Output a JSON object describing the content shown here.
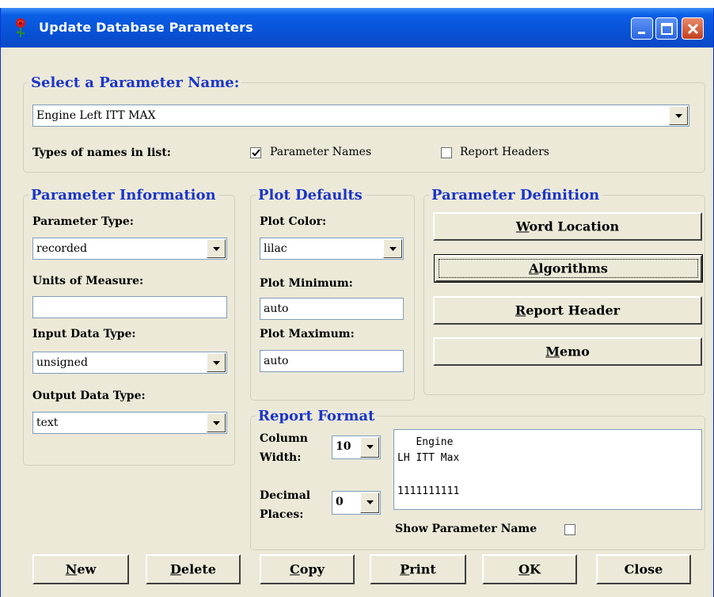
{
  "window": {
    "title": "Update Database Parameters",
    "icon": "rose-icon"
  },
  "select_group": {
    "legend": "Select a Parameter Name:",
    "selected_name": "Engine Left ITT MAX",
    "types_label": "Types of names in list:",
    "parameter_names_label": "Parameter Names",
    "parameter_names_checked": true,
    "report_headers_label": "Report Headers",
    "report_headers_checked": false
  },
  "parameter_info": {
    "legend": "Parameter Information",
    "parameter_type_label": "Parameter Type:",
    "parameter_type_value": "recorded",
    "units_label": "Units of Measure:",
    "units_value": "",
    "input_type_label": "Input Data Type:",
    "input_type_value": "unsigned",
    "output_type_label": "Output Data Type:",
    "output_type_value": "text"
  },
  "plot_defaults": {
    "legend": "Plot Defaults",
    "color_label": "Plot Color:",
    "color_value": "lilac",
    "min_label": "Plot Minimum:",
    "min_value": "auto",
    "max_label": "Plot Maximum:",
    "max_value": "auto"
  },
  "parameter_definition": {
    "legend": "Parameter Definition",
    "buttons": [
      "Word Location",
      "Algorithms",
      "Report Header",
      "Memo"
    ]
  },
  "report_format": {
    "legend": "Report Format",
    "column_width_label_1": "Column",
    "column_width_label_2": "Width:",
    "column_width_value": "10",
    "decimal_label_1": "Decimal",
    "decimal_label_2": "Places:",
    "decimal_value": "0",
    "preview_lines": [
      "   Engine",
      "LH ITT Max",
      "",
      "1111111111"
    ],
    "show_param_name_label": "Show Parameter Name",
    "show_param_name_checked": false
  },
  "bottom_buttons": [
    "New",
    "Delete",
    "Copy",
    "Print",
    "OK",
    "Close"
  ],
  "colors": {
    "titlebar": "#0a5ee6",
    "legend_text": "#1b35c8",
    "dialog_bg": "#ece9d8"
  }
}
